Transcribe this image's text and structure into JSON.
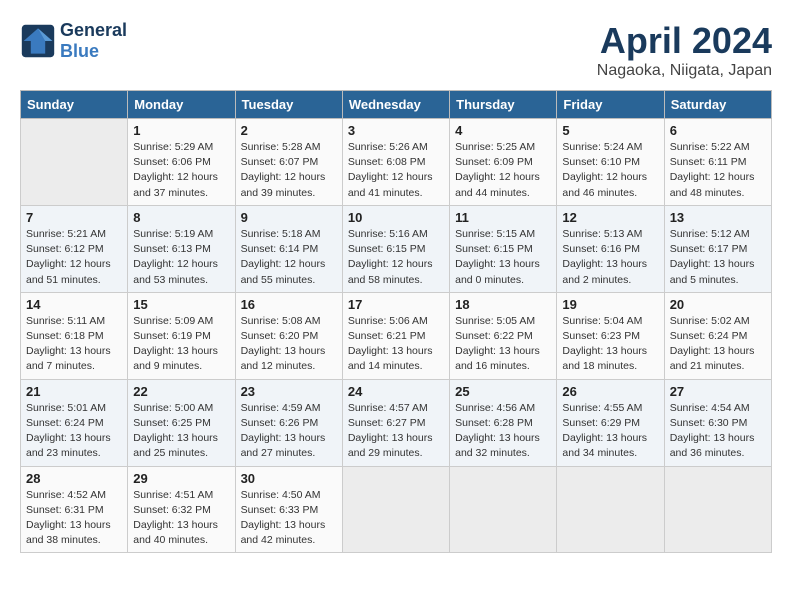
{
  "header": {
    "logo_line1": "General",
    "logo_line2": "Blue",
    "month": "April 2024",
    "location": "Nagaoka, Niigata, Japan"
  },
  "weekdays": [
    "Sunday",
    "Monday",
    "Tuesday",
    "Wednesday",
    "Thursday",
    "Friday",
    "Saturday"
  ],
  "weeks": [
    [
      {
        "day": "",
        "empty": true
      },
      {
        "day": "1",
        "sunrise": "5:29 AM",
        "sunset": "6:06 PM",
        "daylight": "12 hours and 37 minutes."
      },
      {
        "day": "2",
        "sunrise": "5:28 AM",
        "sunset": "6:07 PM",
        "daylight": "12 hours and 39 minutes."
      },
      {
        "day": "3",
        "sunrise": "5:26 AM",
        "sunset": "6:08 PM",
        "daylight": "12 hours and 41 minutes."
      },
      {
        "day": "4",
        "sunrise": "5:25 AM",
        "sunset": "6:09 PM",
        "daylight": "12 hours and 44 minutes."
      },
      {
        "day": "5",
        "sunrise": "5:24 AM",
        "sunset": "6:10 PM",
        "daylight": "12 hours and 46 minutes."
      },
      {
        "day": "6",
        "sunrise": "5:22 AM",
        "sunset": "6:11 PM",
        "daylight": "12 hours and 48 minutes."
      }
    ],
    [
      {
        "day": "7",
        "sunrise": "5:21 AM",
        "sunset": "6:12 PM",
        "daylight": "12 hours and 51 minutes."
      },
      {
        "day": "8",
        "sunrise": "5:19 AM",
        "sunset": "6:13 PM",
        "daylight": "12 hours and 53 minutes."
      },
      {
        "day": "9",
        "sunrise": "5:18 AM",
        "sunset": "6:14 PM",
        "daylight": "12 hours and 55 minutes."
      },
      {
        "day": "10",
        "sunrise": "5:16 AM",
        "sunset": "6:15 PM",
        "daylight": "12 hours and 58 minutes."
      },
      {
        "day": "11",
        "sunrise": "5:15 AM",
        "sunset": "6:15 PM",
        "daylight": "13 hours and 0 minutes."
      },
      {
        "day": "12",
        "sunrise": "5:13 AM",
        "sunset": "6:16 PM",
        "daylight": "13 hours and 2 minutes."
      },
      {
        "day": "13",
        "sunrise": "5:12 AM",
        "sunset": "6:17 PM",
        "daylight": "13 hours and 5 minutes."
      }
    ],
    [
      {
        "day": "14",
        "sunrise": "5:11 AM",
        "sunset": "6:18 PM",
        "daylight": "13 hours and 7 minutes."
      },
      {
        "day": "15",
        "sunrise": "5:09 AM",
        "sunset": "6:19 PM",
        "daylight": "13 hours and 9 minutes."
      },
      {
        "day": "16",
        "sunrise": "5:08 AM",
        "sunset": "6:20 PM",
        "daylight": "13 hours and 12 minutes."
      },
      {
        "day": "17",
        "sunrise": "5:06 AM",
        "sunset": "6:21 PM",
        "daylight": "13 hours and 14 minutes."
      },
      {
        "day": "18",
        "sunrise": "5:05 AM",
        "sunset": "6:22 PM",
        "daylight": "13 hours and 16 minutes."
      },
      {
        "day": "19",
        "sunrise": "5:04 AM",
        "sunset": "6:23 PM",
        "daylight": "13 hours and 18 minutes."
      },
      {
        "day": "20",
        "sunrise": "5:02 AM",
        "sunset": "6:24 PM",
        "daylight": "13 hours and 21 minutes."
      }
    ],
    [
      {
        "day": "21",
        "sunrise": "5:01 AM",
        "sunset": "6:24 PM",
        "daylight": "13 hours and 23 minutes."
      },
      {
        "day": "22",
        "sunrise": "5:00 AM",
        "sunset": "6:25 PM",
        "daylight": "13 hours and 25 minutes."
      },
      {
        "day": "23",
        "sunrise": "4:59 AM",
        "sunset": "6:26 PM",
        "daylight": "13 hours and 27 minutes."
      },
      {
        "day": "24",
        "sunrise": "4:57 AM",
        "sunset": "6:27 PM",
        "daylight": "13 hours and 29 minutes."
      },
      {
        "day": "25",
        "sunrise": "4:56 AM",
        "sunset": "6:28 PM",
        "daylight": "13 hours and 32 minutes."
      },
      {
        "day": "26",
        "sunrise": "4:55 AM",
        "sunset": "6:29 PM",
        "daylight": "13 hours and 34 minutes."
      },
      {
        "day": "27",
        "sunrise": "4:54 AM",
        "sunset": "6:30 PM",
        "daylight": "13 hours and 36 minutes."
      }
    ],
    [
      {
        "day": "28",
        "sunrise": "4:52 AM",
        "sunset": "6:31 PM",
        "daylight": "13 hours and 38 minutes."
      },
      {
        "day": "29",
        "sunrise": "4:51 AM",
        "sunset": "6:32 PM",
        "daylight": "13 hours and 40 minutes."
      },
      {
        "day": "30",
        "sunrise": "4:50 AM",
        "sunset": "6:33 PM",
        "daylight": "13 hours and 42 minutes."
      },
      {
        "day": "",
        "empty": true
      },
      {
        "day": "",
        "empty": true
      },
      {
        "day": "",
        "empty": true
      },
      {
        "day": "",
        "empty": true
      }
    ]
  ]
}
